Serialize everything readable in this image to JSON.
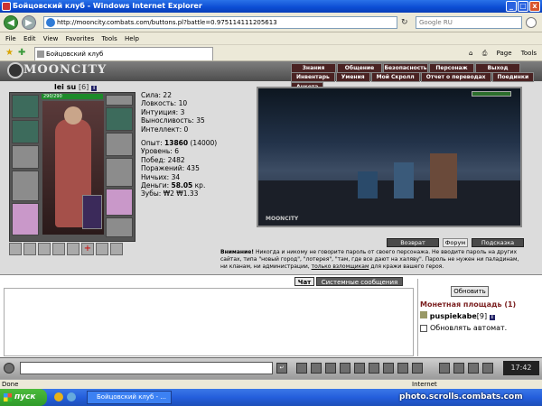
{
  "window": {
    "title": "Бойцовский клуб - Windows Internet Explorer",
    "min": "_",
    "max": "□",
    "close": "x"
  },
  "browser": {
    "url": "http://mooncity.combats.com/buttons.pl?battle=0.975114111205613",
    "search_placeholder": "Google RU",
    "menu": [
      "File",
      "Edit",
      "View",
      "Favorites",
      "Tools",
      "Help"
    ],
    "tab_title": "Бойцовский клуб",
    "tools": [
      "Page",
      "Tools"
    ]
  },
  "game": {
    "logo": "MOONCITY",
    "topnav": [
      "Знания",
      "Общение",
      "Безопасность",
      "Персонаж",
      "Выход"
    ],
    "subnav": [
      "Инвентарь",
      "Умения",
      "Мой Скролл",
      "Отчет о переводах",
      "Поединки",
      "Анкета"
    ],
    "character": {
      "name": "lei su",
      "level": "[6]",
      "info": "i",
      "hp": "290/290",
      "hp_fraction": 1.0
    },
    "stats": [
      {
        "label": "Сила:",
        "value": "22"
      },
      {
        "label": "Ловкость:",
        "value": "10"
      },
      {
        "label": "Интуиция:",
        "value": "3"
      },
      {
        "label": "Выносливость:",
        "value": "35"
      },
      {
        "label": "Интеллект:",
        "value": "0"
      }
    ],
    "progress": [
      {
        "label": "Опыт:",
        "value": "13860",
        "extra": " (14000)"
      },
      {
        "label": "Уровень:",
        "value": "6"
      },
      {
        "label": "Побед:",
        "value": "2482"
      },
      {
        "label": "Поражений:",
        "value": "435"
      },
      {
        "label": "Ничьих:",
        "value": "34"
      },
      {
        "label": "Деньги:",
        "value": "58.05",
        "extra": " кр."
      },
      {
        "label": "Зубы:",
        "value": "₩2 ₩1.33"
      }
    ],
    "scene_logo": "MOONCITY",
    "buttons": {
      "back": "Возврат",
      "forum": "Форум",
      "support": "Подсказка"
    },
    "warning": {
      "bold": "Внимание!",
      "text": " Никогда и никому не говорите пароль от своего персонажа. Не вводите пароль на других сайтах, типа \"новый город\", \"лотерея\", \"там, где все дают на халяву\". Пароль не нужен ни паладинам, ни кланам, ни администрации, ",
      "link": "только взломщикам",
      "tail": " для кражи вашего героя."
    }
  },
  "chat": {
    "tabs": {
      "chat": "Чат",
      "system": "Системные сообщения"
    },
    "refresh": "Обновить",
    "location": "Монетная площадь (1)",
    "user": {
      "name": "puspiekabe",
      "level": "[9]",
      "info": "i"
    },
    "auto": "Обновлять автомат.",
    "clock": "17:42"
  },
  "status": {
    "left": "Done",
    "zone": "Internet"
  },
  "taskbar": {
    "start": "пуск",
    "item": "Бойцовский клуб - ..."
  },
  "watermark": "photo.scrolls.combats.com"
}
